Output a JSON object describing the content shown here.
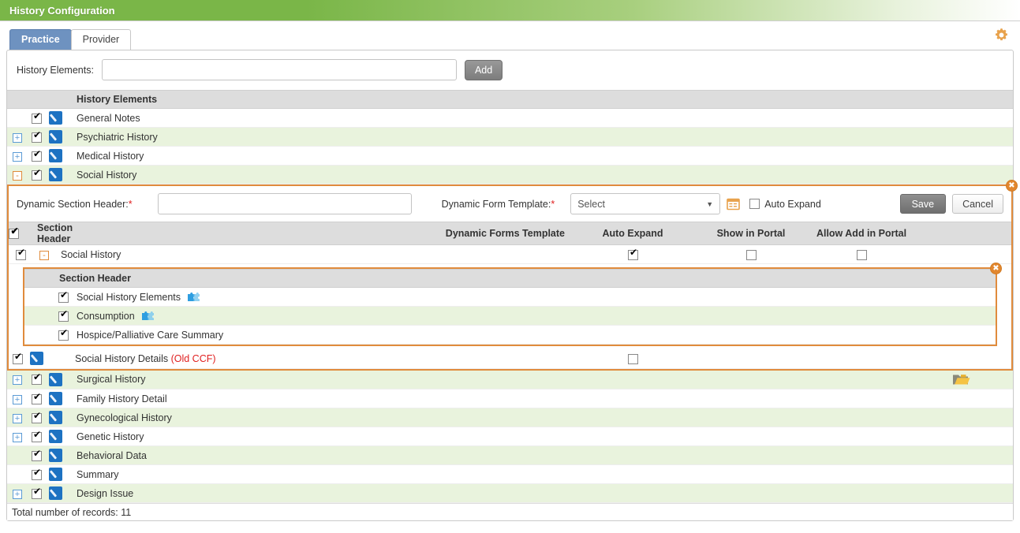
{
  "window": {
    "title": "History Configuration"
  },
  "tabs": [
    {
      "label": "Practice",
      "active": true
    },
    {
      "label": "Provider",
      "active": false
    }
  ],
  "icons": {
    "gear": "gear-icon",
    "folder": "folder-open-icon",
    "calendar": "calendar-form-icon",
    "puzzle": "puzzle-piece-icon",
    "close": "✖"
  },
  "search": {
    "label": "History Elements:",
    "value": "",
    "placeholder": "",
    "add_label": "Add"
  },
  "grid": {
    "header": "History Elements",
    "rows": [
      {
        "label": "General Notes",
        "expander": "",
        "checked": true,
        "edit": true,
        "alt": false
      },
      {
        "label": "Psychiatric History",
        "expander": "+",
        "checked": true,
        "edit": true,
        "alt": true
      },
      {
        "label": "Medical History",
        "expander": "+",
        "checked": true,
        "edit": true,
        "alt": false
      },
      {
        "label": "Social History",
        "expander": "-",
        "checked": true,
        "edit": true,
        "alt": true
      }
    ],
    "rows_after": [
      {
        "label": "Surgical History",
        "expander": "+",
        "checked": true,
        "edit": true,
        "alt": true,
        "folder": true
      },
      {
        "label": "Family History Detail",
        "expander": "+",
        "checked": true,
        "edit": true,
        "alt": false,
        "folder": false
      },
      {
        "label": "Gynecological History",
        "expander": "+",
        "checked": true,
        "edit": true,
        "alt": true,
        "folder": false
      },
      {
        "label": "Genetic History",
        "expander": "+",
        "checked": true,
        "edit": true,
        "alt": false,
        "folder": false
      },
      {
        "label": "Behavioral Data",
        "expander": "",
        "checked": true,
        "edit": true,
        "alt": true,
        "folder": false
      },
      {
        "label": "Summary",
        "expander": "",
        "checked": true,
        "edit": true,
        "alt": false,
        "folder": false
      },
      {
        "label": "Design Issue",
        "expander": "+",
        "checked": true,
        "edit": true,
        "alt": true,
        "folder": false
      }
    ],
    "footer": "Total number of records: 11"
  },
  "dynamic_panel": {
    "section_header_label": "Dynamic Section Header:",
    "section_header_value": "",
    "form_template_label": "Dynamic Form Template:",
    "form_template_selected": "Select",
    "auto_expand_label": "Auto Expand",
    "auto_expand_checked": false,
    "save_label": "Save",
    "cancel_label": "Cancel",
    "columns": {
      "section_header": "Section Header",
      "dynamic_forms_template": "Dynamic Forms Template",
      "auto_expand": "Auto Expand",
      "show_in_portal": "Show in Portal",
      "allow_add_in_portal": "Allow Add in Portal"
    },
    "rows": [
      {
        "label": "Social History",
        "expander": "-",
        "checked": true,
        "template": "",
        "auto_expand": true,
        "show_in_portal": false,
        "allow_add_in_portal": false
      }
    ],
    "inner": {
      "header": "Section Header",
      "rows": [
        {
          "label": "Social History Elements",
          "checked": true,
          "puzzle": true,
          "alt": false
        },
        {
          "label": "Consumption",
          "checked": true,
          "puzzle": true,
          "alt": true
        },
        {
          "label": "Hospice/Palliative Care Summary",
          "checked": true,
          "puzzle": false,
          "alt": false
        }
      ]
    },
    "details_row": {
      "label": "Social History Details ",
      "label_note": "(Old CCF)",
      "checked": true,
      "edit": true,
      "auto_expand": false
    }
  },
  "colors": {
    "title_green": "#7ab648",
    "tab_blue": "#6e92c0",
    "accent_orange": "#e08b3c",
    "row_green": "#e9f3dd",
    "header_grey": "#dddddd",
    "required_red": "#e02020"
  }
}
